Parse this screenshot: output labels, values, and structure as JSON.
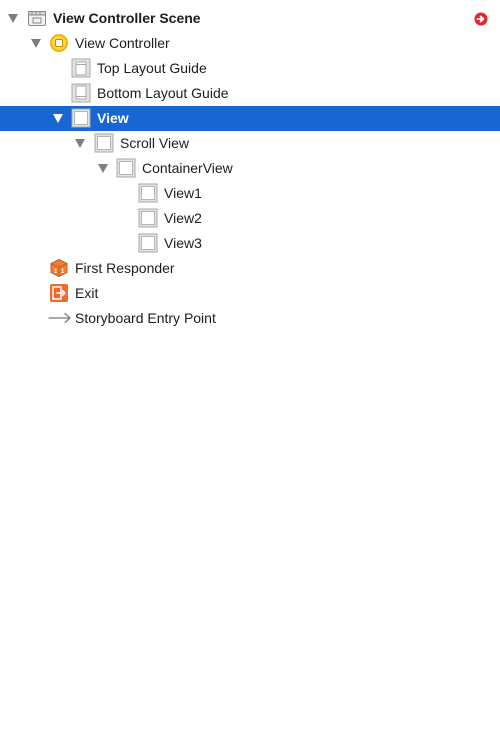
{
  "scene": {
    "title": "View Controller Scene",
    "items": {
      "view_controller": "View Controller",
      "top_layout_guide": "Top Layout Guide",
      "bottom_layout_guide": "Bottom Layout Guide",
      "view": "View",
      "scroll_view": "Scroll View",
      "container_view": "ContainerView",
      "view1": "View1",
      "view2": "View2",
      "view3": "View3",
      "first_responder": "First Responder",
      "exit": "Exit",
      "storyboard_entry_point": "Storyboard Entry Point"
    },
    "selected_item": "View"
  },
  "icons": {
    "scene": "scene-icon",
    "view_controller": "view-controller-icon",
    "layout_guide": "layout-guide-icon",
    "view": "view-icon",
    "first_responder": "first-responder-icon",
    "exit": "exit-icon",
    "entry_point": "arrow-right-icon",
    "warning": "warning-arrow-icon"
  },
  "colors": {
    "selection": "#1766d4",
    "view_controller_accent": "#f5b400",
    "first_responder_accent": "#f07d3a",
    "exit_accent": "#f06a2a",
    "warning_red": "#e8242b"
  }
}
